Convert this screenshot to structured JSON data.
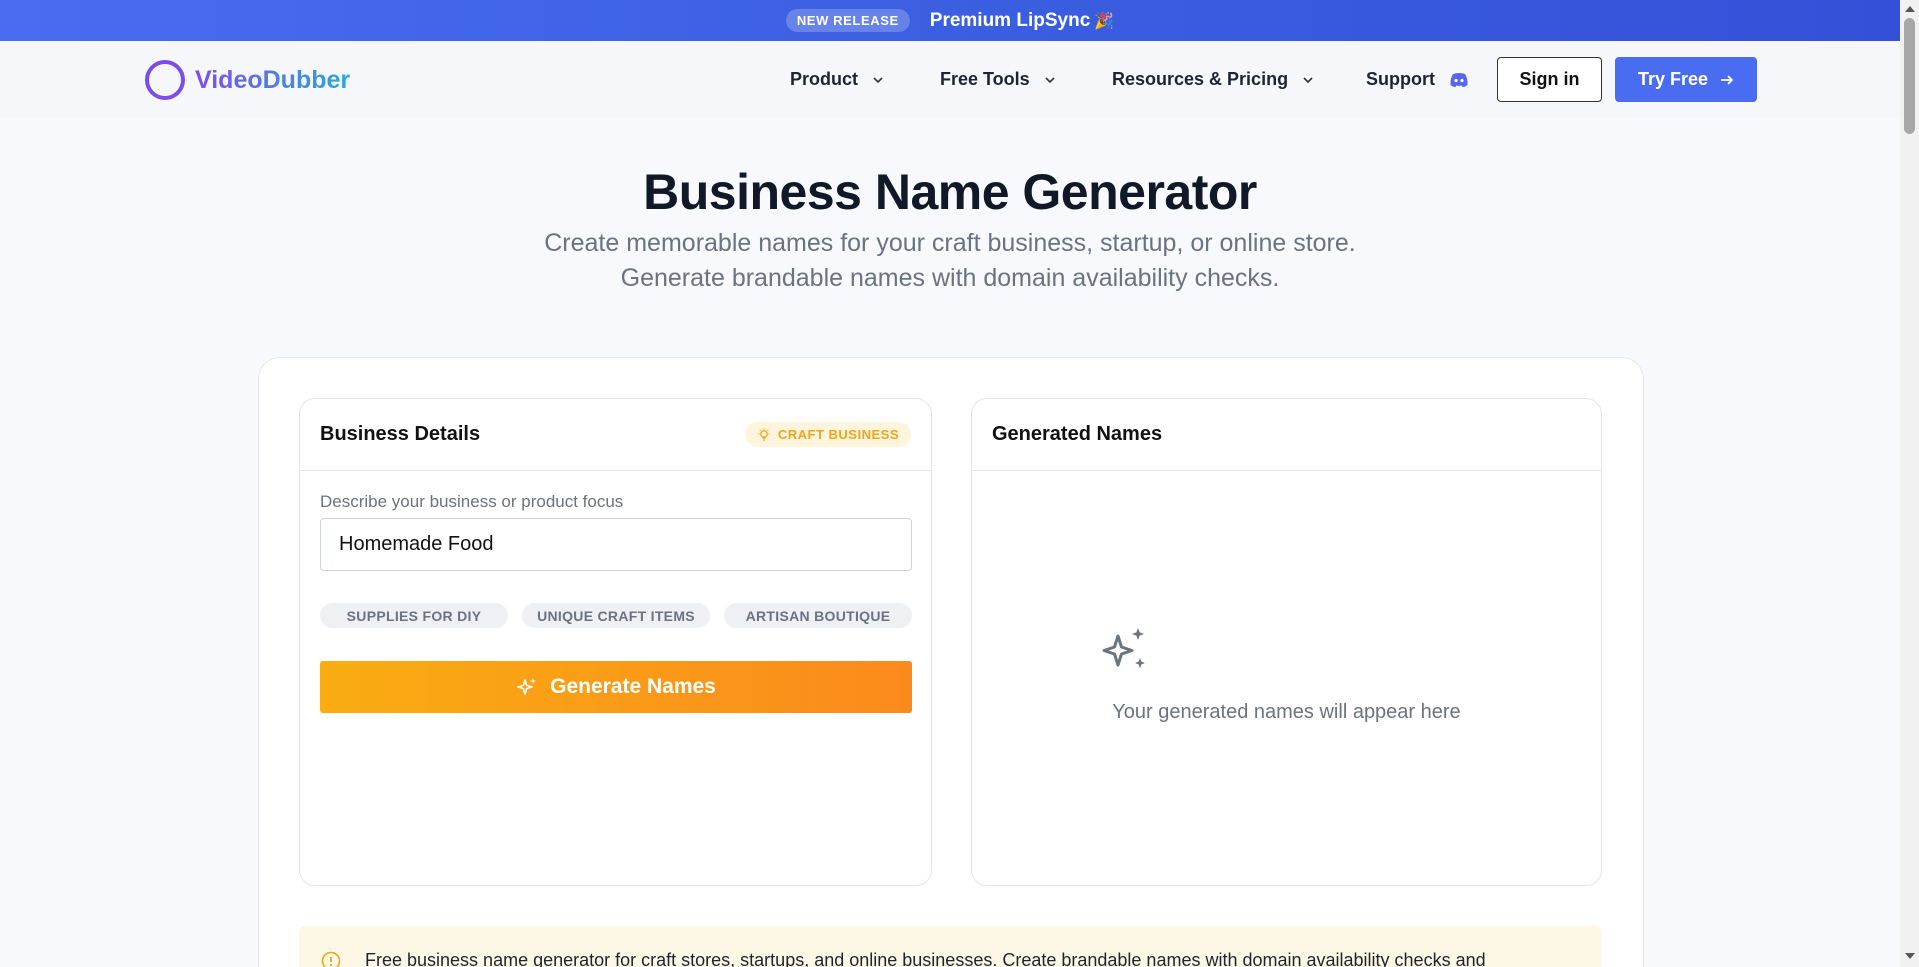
{
  "announcement": {
    "badge": "NEW RELEASE",
    "message": "Premium LipSync",
    "emoji": "🎉"
  },
  "header": {
    "logo_text": "VideoDubber",
    "nav": [
      {
        "label": "Product"
      },
      {
        "label": "Free Tools"
      },
      {
        "label": "Resources & Pricing"
      },
      {
        "label": "Support"
      }
    ],
    "sign_in": "Sign in",
    "try_free": "Try Free"
  },
  "hero": {
    "title": "Business Name Generator",
    "subtitle": "Create memorable names for your craft business, startup, or online store. Generate brandable names with domain availability checks."
  },
  "details_panel": {
    "title": "Business Details",
    "badge": "CRAFT BUSINESS",
    "field_label": "Describe your business or product focus",
    "field_value": "Homemade Food",
    "chips": [
      "SUPPLIES FOR DIY",
      "UNIQUE CRAFT ITEMS",
      "ARTISAN BOUTIQUE"
    ],
    "generate_label": "Generate Names"
  },
  "results_panel": {
    "title": "Generated Names",
    "empty_text": "Your generated names will appear here"
  },
  "info": {
    "text": "Free business name generator for craft stores, startups, and online businesses. Create brandable names with domain availability checks and"
  },
  "colors": {
    "brand_blue": "#4a6cf0",
    "logo_purple": "#7c4dec",
    "accent_orange": "#fb8a1d",
    "badge_amber": "#f2a516"
  }
}
